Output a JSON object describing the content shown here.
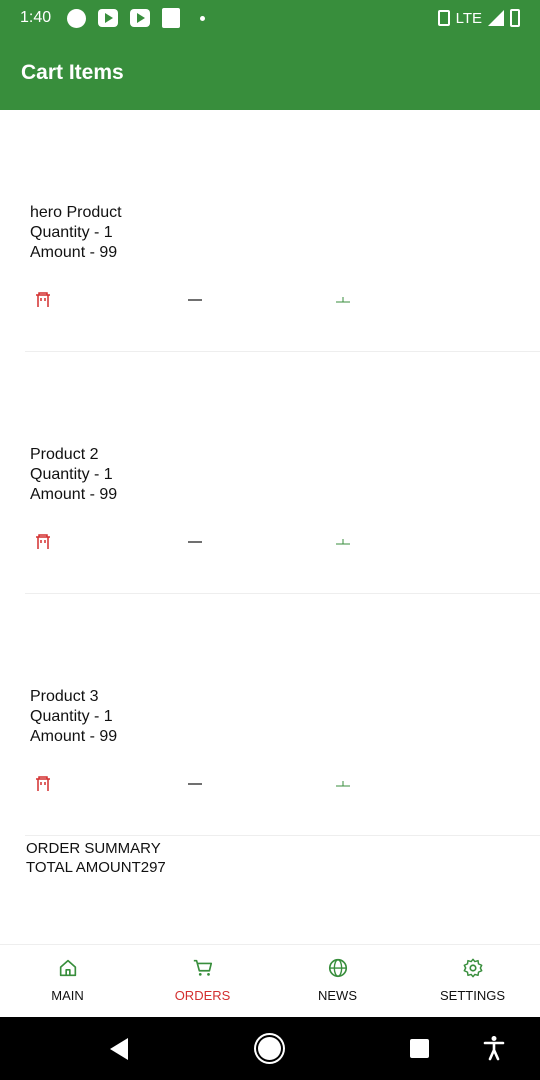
{
  "status_bar": {
    "time": "1:40",
    "network": "LTE",
    "icons": [
      "pocket-casts-icon",
      "youtube-icon",
      "youtube-icon",
      "news-icon",
      "dot-icon"
    ]
  },
  "app_bar": {
    "title": "Cart Items"
  },
  "cart_items": [
    {
      "name": "hero Product",
      "quantity": "Quantity - 1",
      "amount": "Amount - 99"
    },
    {
      "name": "Product 2",
      "quantity": "Quantity - 1",
      "amount": "Amount - 99"
    },
    {
      "name": "Product 3",
      "quantity": "Quantity - 1",
      "amount": "Amount - 99"
    }
  ],
  "summary": {
    "heading": "ORDER SUMMARY",
    "total": "TOTAL AMOUNT297"
  },
  "bottom_nav": [
    {
      "label": "MAIN",
      "icon": "home-icon",
      "active": false
    },
    {
      "label": "ORDERS",
      "icon": "cart-icon",
      "active": true
    },
    {
      "label": "NEWS",
      "icon": "globe-icon",
      "active": false
    },
    {
      "label": "SETTINGS",
      "icon": "gear-icon",
      "active": false
    }
  ],
  "colors": {
    "primary": "#388e3c",
    "delete": "#d32f2f",
    "active_nav": "#d32f2f"
  }
}
